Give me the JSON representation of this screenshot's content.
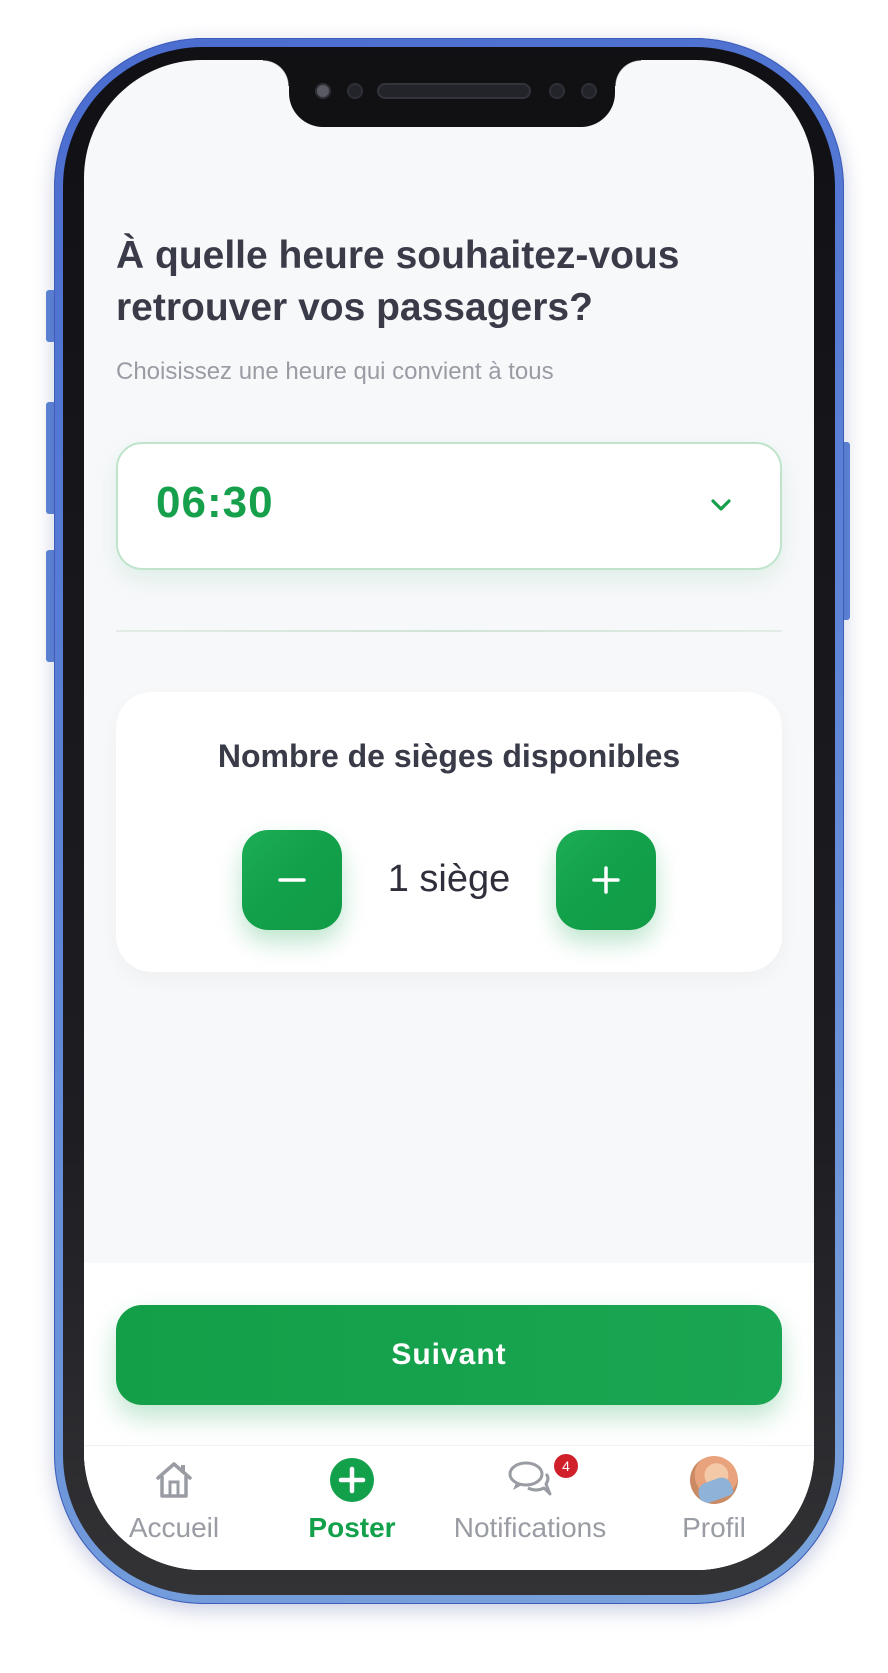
{
  "screen": {
    "question": "À quelle heure souhaitez-vous retrouver vos passagers?",
    "subtitle": "Choisissez une heure qui convient à tous"
  },
  "time_select": {
    "value": "06:30",
    "icon": "chevron-down-icon"
  },
  "seats": {
    "title": "Nombre de sièges disponibles",
    "count_label": "1 siège",
    "count": 1,
    "minus_icon": "minus-icon",
    "plus_icon": "plus-icon"
  },
  "next_button": {
    "label": "Suivant"
  },
  "tabbar": {
    "items": [
      {
        "label": "Accueil",
        "icon": "home-icon",
        "active": false
      },
      {
        "label": "Poster",
        "icon": "plus-circle-icon",
        "active": true
      },
      {
        "label": "Notifications",
        "icon": "chat-bubbles-icon",
        "active": false,
        "badge": "4"
      },
      {
        "label": "Profil",
        "icon": "avatar",
        "active": false
      }
    ]
  },
  "colors": {
    "accent": "#12a04a",
    "title": "#3a3b48",
    "muted": "#9a9ca4",
    "badge": "#d0202a",
    "frame": "#5f86d8"
  }
}
